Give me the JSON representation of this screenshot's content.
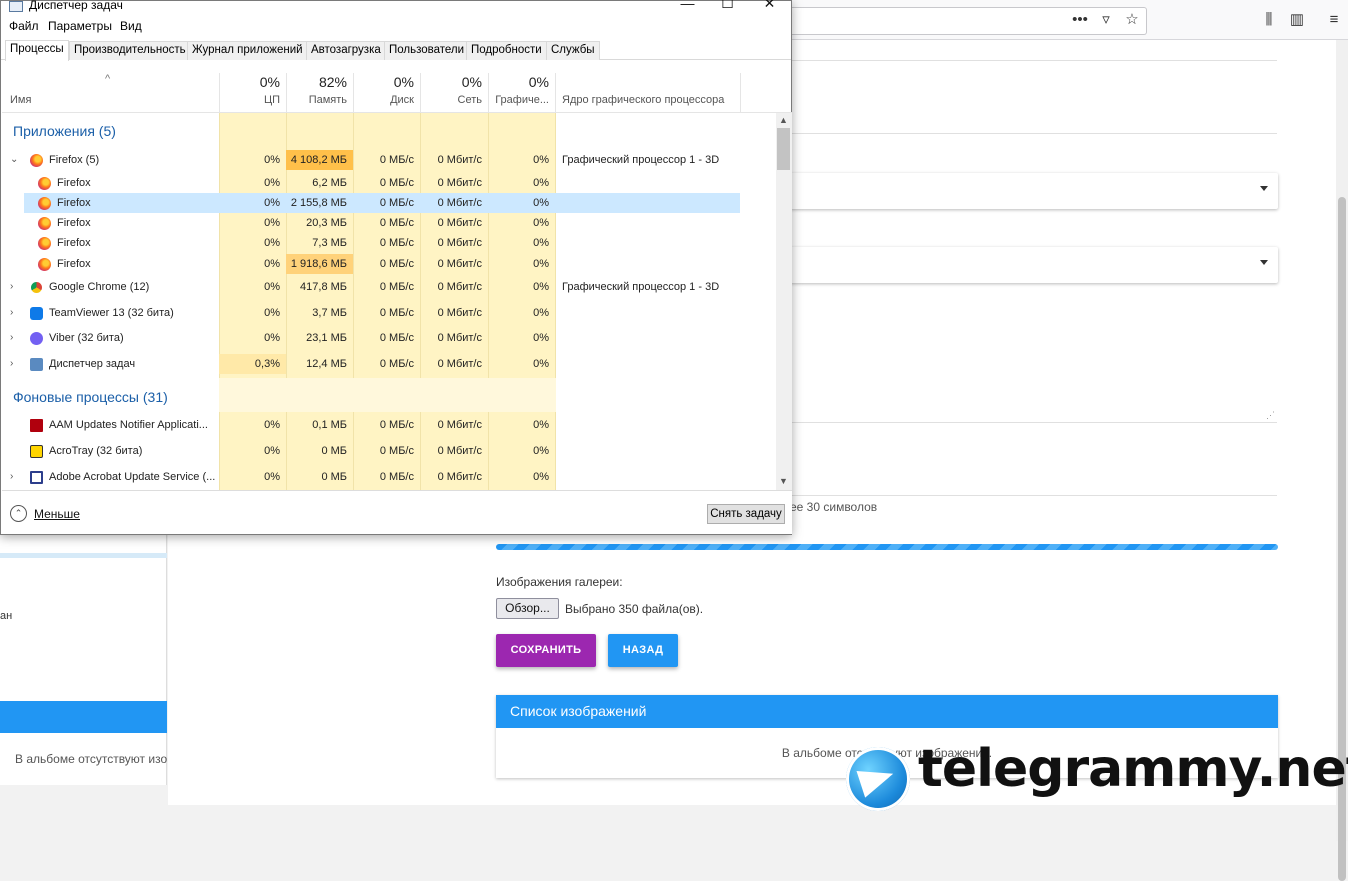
{
  "task_manager": {
    "title": "Диспетчер задач",
    "window_controls": {
      "minimize": "—",
      "maximize": "☐",
      "close": "✕"
    },
    "menu": [
      "Файл",
      "Параметры",
      "Вид"
    ],
    "tabs": [
      "Процессы",
      "Производительность",
      "Журнал приложений",
      "Автозагрузка",
      "Пользователи",
      "Подробности",
      "Службы"
    ],
    "columns": {
      "name": "Имя",
      "cpu": {
        "pct": "0%",
        "label": "ЦП"
      },
      "memory": {
        "pct": "82%",
        "label": "Память"
      },
      "disk": {
        "pct": "0%",
        "label": "Диск"
      },
      "network": {
        "pct": "0%",
        "label": "Сеть"
      },
      "gpu": {
        "pct": "0%",
        "label": "Графиче..."
      },
      "gpu_engine": "Ядро графического процессора"
    },
    "groups": {
      "apps": "Приложения (5)",
      "background": "Фоновые процессы (31)"
    },
    "rows": [
      {
        "name": "Firefox (5)",
        "cpu": "0%",
        "mem": "4 108,2 МБ",
        "disk": "0 МБ/с",
        "net": "0 Мбит/с",
        "gpu": "0%",
        "engine": "Графический процессор 1 - 3D"
      },
      {
        "name": "Firefox",
        "cpu": "0%",
        "mem": "6,2 МБ",
        "disk": "0 МБ/с",
        "net": "0 Мбит/с",
        "gpu": "0%",
        "engine": ""
      },
      {
        "name": "Firefox",
        "cpu": "0%",
        "mem": "2 155,8 МБ",
        "disk": "0 МБ/с",
        "net": "0 Мбит/с",
        "gpu": "0%",
        "engine": ""
      },
      {
        "name": "Firefox",
        "cpu": "0%",
        "mem": "20,3 МБ",
        "disk": "0 МБ/с",
        "net": "0 Мбит/с",
        "gpu": "0%",
        "engine": ""
      },
      {
        "name": "Firefox",
        "cpu": "0%",
        "mem": "7,3 МБ",
        "disk": "0 МБ/с",
        "net": "0 Мбит/с",
        "gpu": "0%",
        "engine": ""
      },
      {
        "name": "Firefox",
        "cpu": "0%",
        "mem": "1 918,6 МБ",
        "disk": "0 МБ/с",
        "net": "0 Мбит/с",
        "gpu": "0%",
        "engine": ""
      },
      {
        "name": "Google Chrome (12)",
        "cpu": "0%",
        "mem": "417,8 МБ",
        "disk": "0 МБ/с",
        "net": "0 Мбит/с",
        "gpu": "0%",
        "engine": "Графический процессор 1 - 3D"
      },
      {
        "name": "TeamViewer 13 (32 бита)",
        "cpu": "0%",
        "mem": "3,7 МБ",
        "disk": "0 МБ/с",
        "net": "0 Мбит/с",
        "gpu": "0%",
        "engine": ""
      },
      {
        "name": "Viber (32 бита)",
        "cpu": "0%",
        "mem": "23,1 МБ",
        "disk": "0 МБ/с",
        "net": "0 Мбит/с",
        "gpu": "0%",
        "engine": ""
      },
      {
        "name": "Диспетчер задач",
        "cpu": "0,3%",
        "mem": "12,4 МБ",
        "disk": "0 МБ/с",
        "net": "0 Мбит/с",
        "gpu": "0%",
        "engine": ""
      },
      {
        "name": "AAM Updates Notifier Applicati...",
        "cpu": "0%",
        "mem": "0,1 МБ",
        "disk": "0 МБ/с",
        "net": "0 Мбит/с",
        "gpu": "0%",
        "engine": ""
      },
      {
        "name": "AcroTray (32 бита)",
        "cpu": "0%",
        "mem": "0 МБ",
        "disk": "0 МБ/с",
        "net": "0 Мбит/с",
        "gpu": "0%",
        "engine": ""
      },
      {
        "name": "Adobe Acrobat Update Service (...",
        "cpu": "0%",
        "mem": "0 МБ",
        "disk": "0 МБ/с",
        "net": "0 Мбит/с",
        "gpu": "0%",
        "engine": ""
      }
    ],
    "footer": {
      "less": "Меньше",
      "end_task": "Снять задачу"
    }
  },
  "browser": {
    "hint_text": "ее 30 символов",
    "gallery_label": "Изображения галереи:",
    "browse_label": "Обзор...",
    "files_chosen": "Выбрано 350 файла(ов).",
    "save_label": "СОХРАНИТЬ",
    "back_label": "НАЗАД",
    "images_list_title": "Список изображений",
    "images_empty": "В альбоме отсутствуют изображения.",
    "left_panel_text": "ан",
    "left_panel_empty": "В альбоме отсутствуют изо"
  },
  "watermark": {
    "text": "telegrammy.net"
  },
  "colors": {
    "purple": "#9c27b0",
    "blue": "#2196f3",
    "mem_high": "#ffc04a",
    "selection": "#cce8ff"
  }
}
